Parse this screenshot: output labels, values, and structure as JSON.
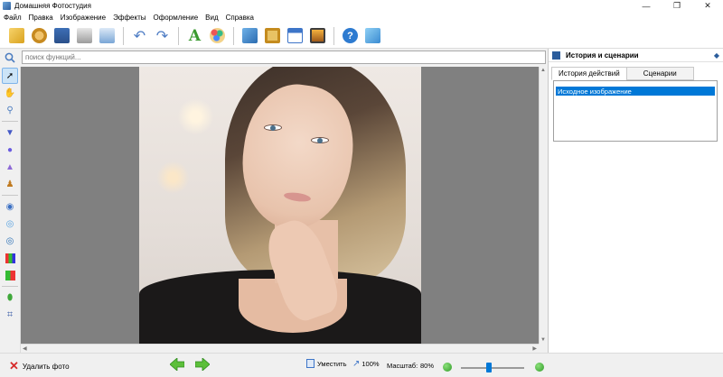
{
  "window": {
    "title": "Домашняя Фотостудия",
    "controls": [
      "—",
      "❐",
      "✕"
    ]
  },
  "menu": [
    "Файл",
    "Правка",
    "Изображение",
    "Эффекты",
    "Оформление",
    "Вид",
    "Справка"
  ],
  "search": {
    "placeholder": "поиск функций..."
  },
  "right_panel": {
    "title": "История и сценарии",
    "tabs": [
      "История действий",
      "Сценарии"
    ],
    "active_tab": "История действий",
    "history": [
      "Исходное изображение"
    ]
  },
  "status": {
    "delete_label": "Удалить фото",
    "fit_label": "Уместить",
    "actual_label": "100%",
    "zoom_label": "Масштаб:",
    "zoom_value": "80%"
  },
  "colors": {
    "accent": "#0078d7",
    "canvas_bg": "#808080"
  }
}
